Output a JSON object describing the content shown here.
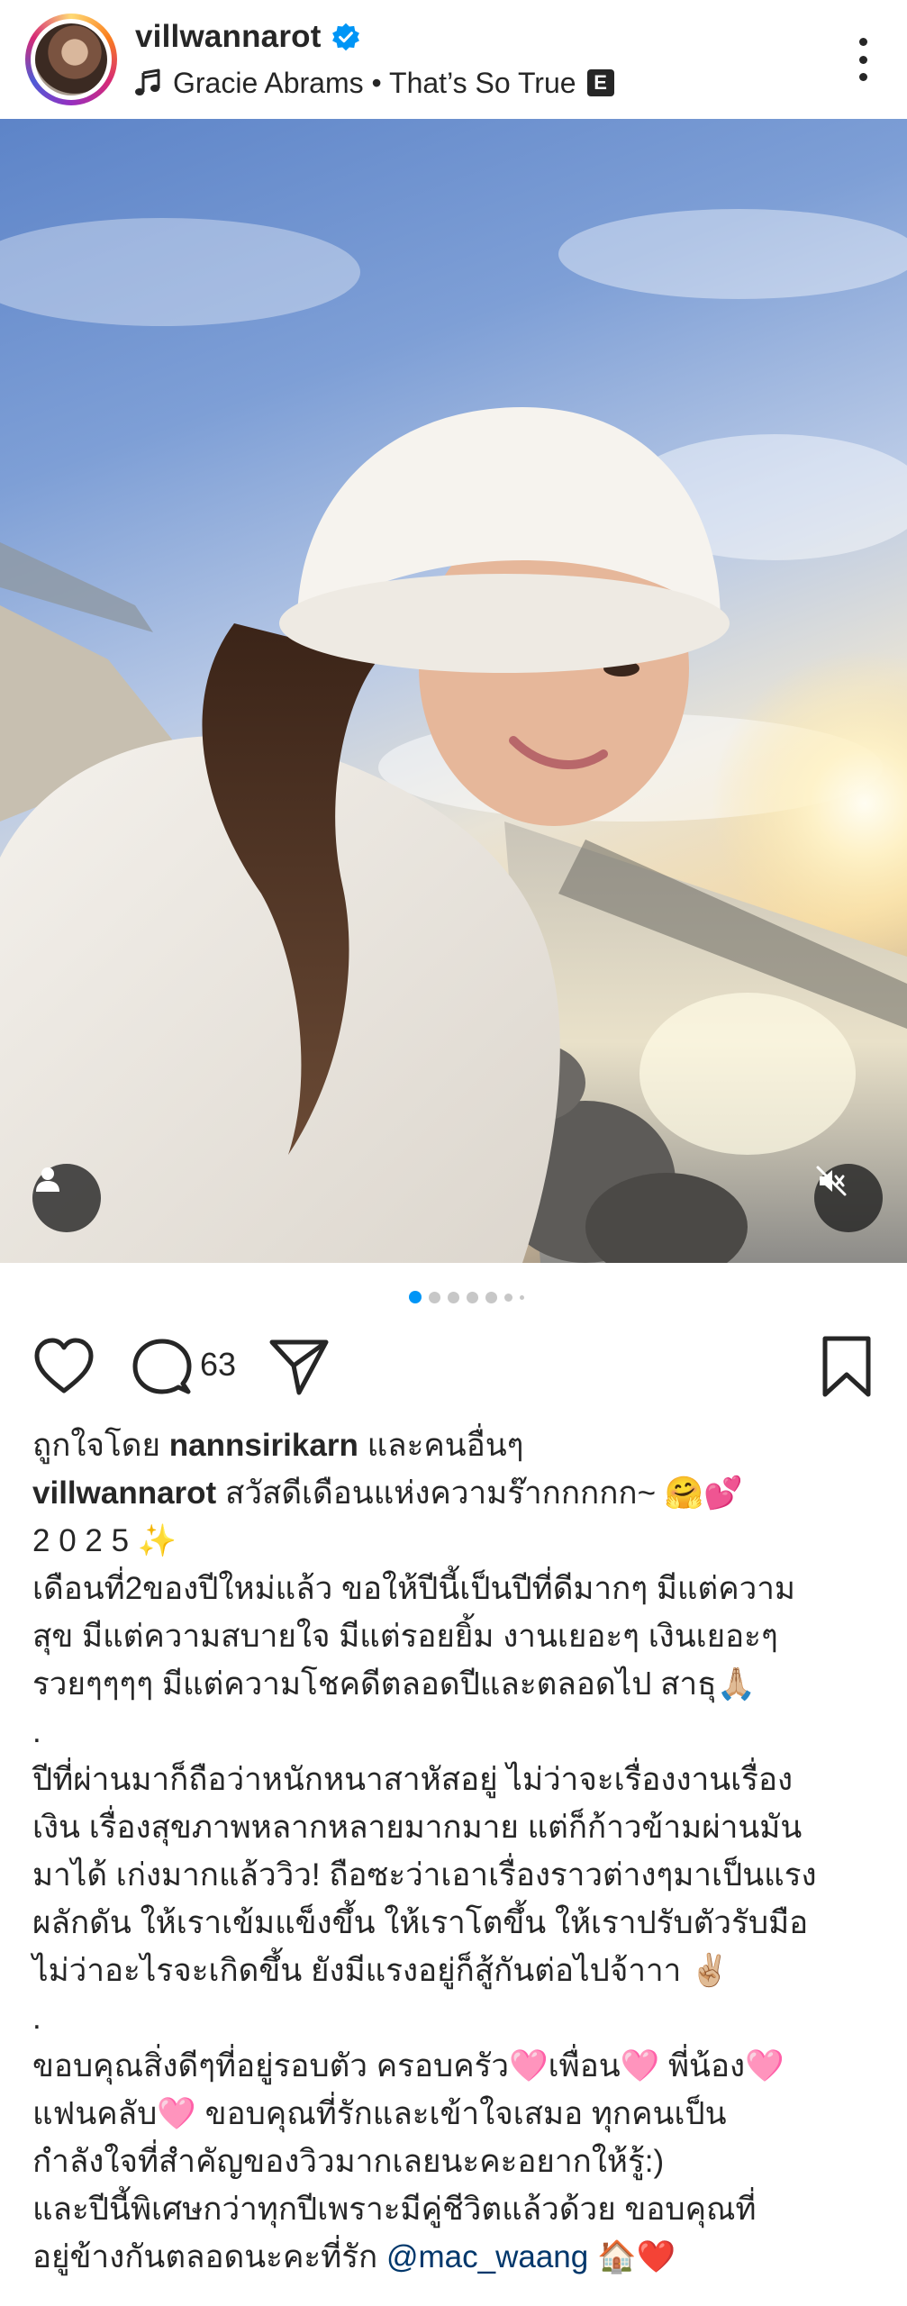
{
  "header": {
    "username": "villwannarot",
    "verified_icon": "verified-badge-icon",
    "music_icon": "music-note-icon",
    "music_text": "Gracie Abrams • That’s So True",
    "explicit_badge": "E",
    "more_icon": "more-vertical-icon"
  },
  "media": {
    "user_tag_icon": "person-icon",
    "mute_icon": "speaker-muted-icon",
    "carousel": {
      "total_visible_dots": 7,
      "active_index": 0
    }
  },
  "actions": {
    "like_icon": "heart-icon",
    "comment_icon": "comment-bubble-icon",
    "comment_count": "63",
    "share_icon": "send-paper-plane-icon",
    "save_icon": "bookmark-icon"
  },
  "likes": {
    "prefix": "ถูกใจโดย",
    "liker": "nannsirikarn",
    "suffix": "และคนอื่นๆ"
  },
  "caption": {
    "username": "villwannarot",
    "line1": "สวัสดีเดือนแห่งความร๊ากกกกก~ 🤗💕",
    "line2": "2 0 2 5 ✨",
    "line3": "เดือนที่2ของปีใหม่แล้ว ขอให้ปีนี้เป็นปีที่ดีมากๆ มีแต่ความ",
    "line4": "สุข มีแต่ความสบายใจ มีแต่รอยยิ้ม งานเยอะๆ เงินเยอะๆ",
    "line5": "รวยๆๆๆๆ มีแต่ความโชคดีตลอดปีและตลอดไป สาธุ🙏🏼",
    "line6": ".",
    "line7": "ปีที่ผ่านมาก็ถือว่าหนักหนาสาหัสอยู่ ไม่ว่าจะเรื่องงานเรื่อง",
    "line8": "เงิน เรื่องสุขภาพหลากหลายมากมาย แต่ก็ก้าวข้ามผ่านมัน",
    "line9": "มาได้ เก่งมากแล้ววิว! ถือซะว่าเอาเรื่องราวต่างๆมาเป็นแรง",
    "line10": "ผลักดัน ให้เราเข้มแข็งขึ้น ให้เราโตขึ้น ให้เราปรับตัวรับมือ",
    "line11": "ไม่ว่าอะไรจะเกิดขึ้น ยังมีแรงอยู่ก็สู้กันต่อไปจ้าาา ✌🏼",
    "line12": ".",
    "line13": "ขอบคุณสิ่งดีๆที่อยู่รอบตัว ครอบครัว🩷เพื่อน🩷 พี่น้อง🩷",
    "line14": "แฟนคลับ🩷 ขอบคุณที่รักและเข้าใจเสมอ ทุกคนเป็น",
    "line15": "กำลังใจที่สำคัญของวิวมากเลยนะคะอยากให้รู้:)",
    "line16": "และปีนี้พิเศษกว่าทุกปีเพราะมีคู่ชีวิตแล้วด้วย ขอบคุณที่",
    "line17_text": "อยู่ข้างกันตลอดนะคะที่รัก ",
    "line17_mention": "@mac_waang",
    "line17_emoji": " 🏠❤️"
  }
}
